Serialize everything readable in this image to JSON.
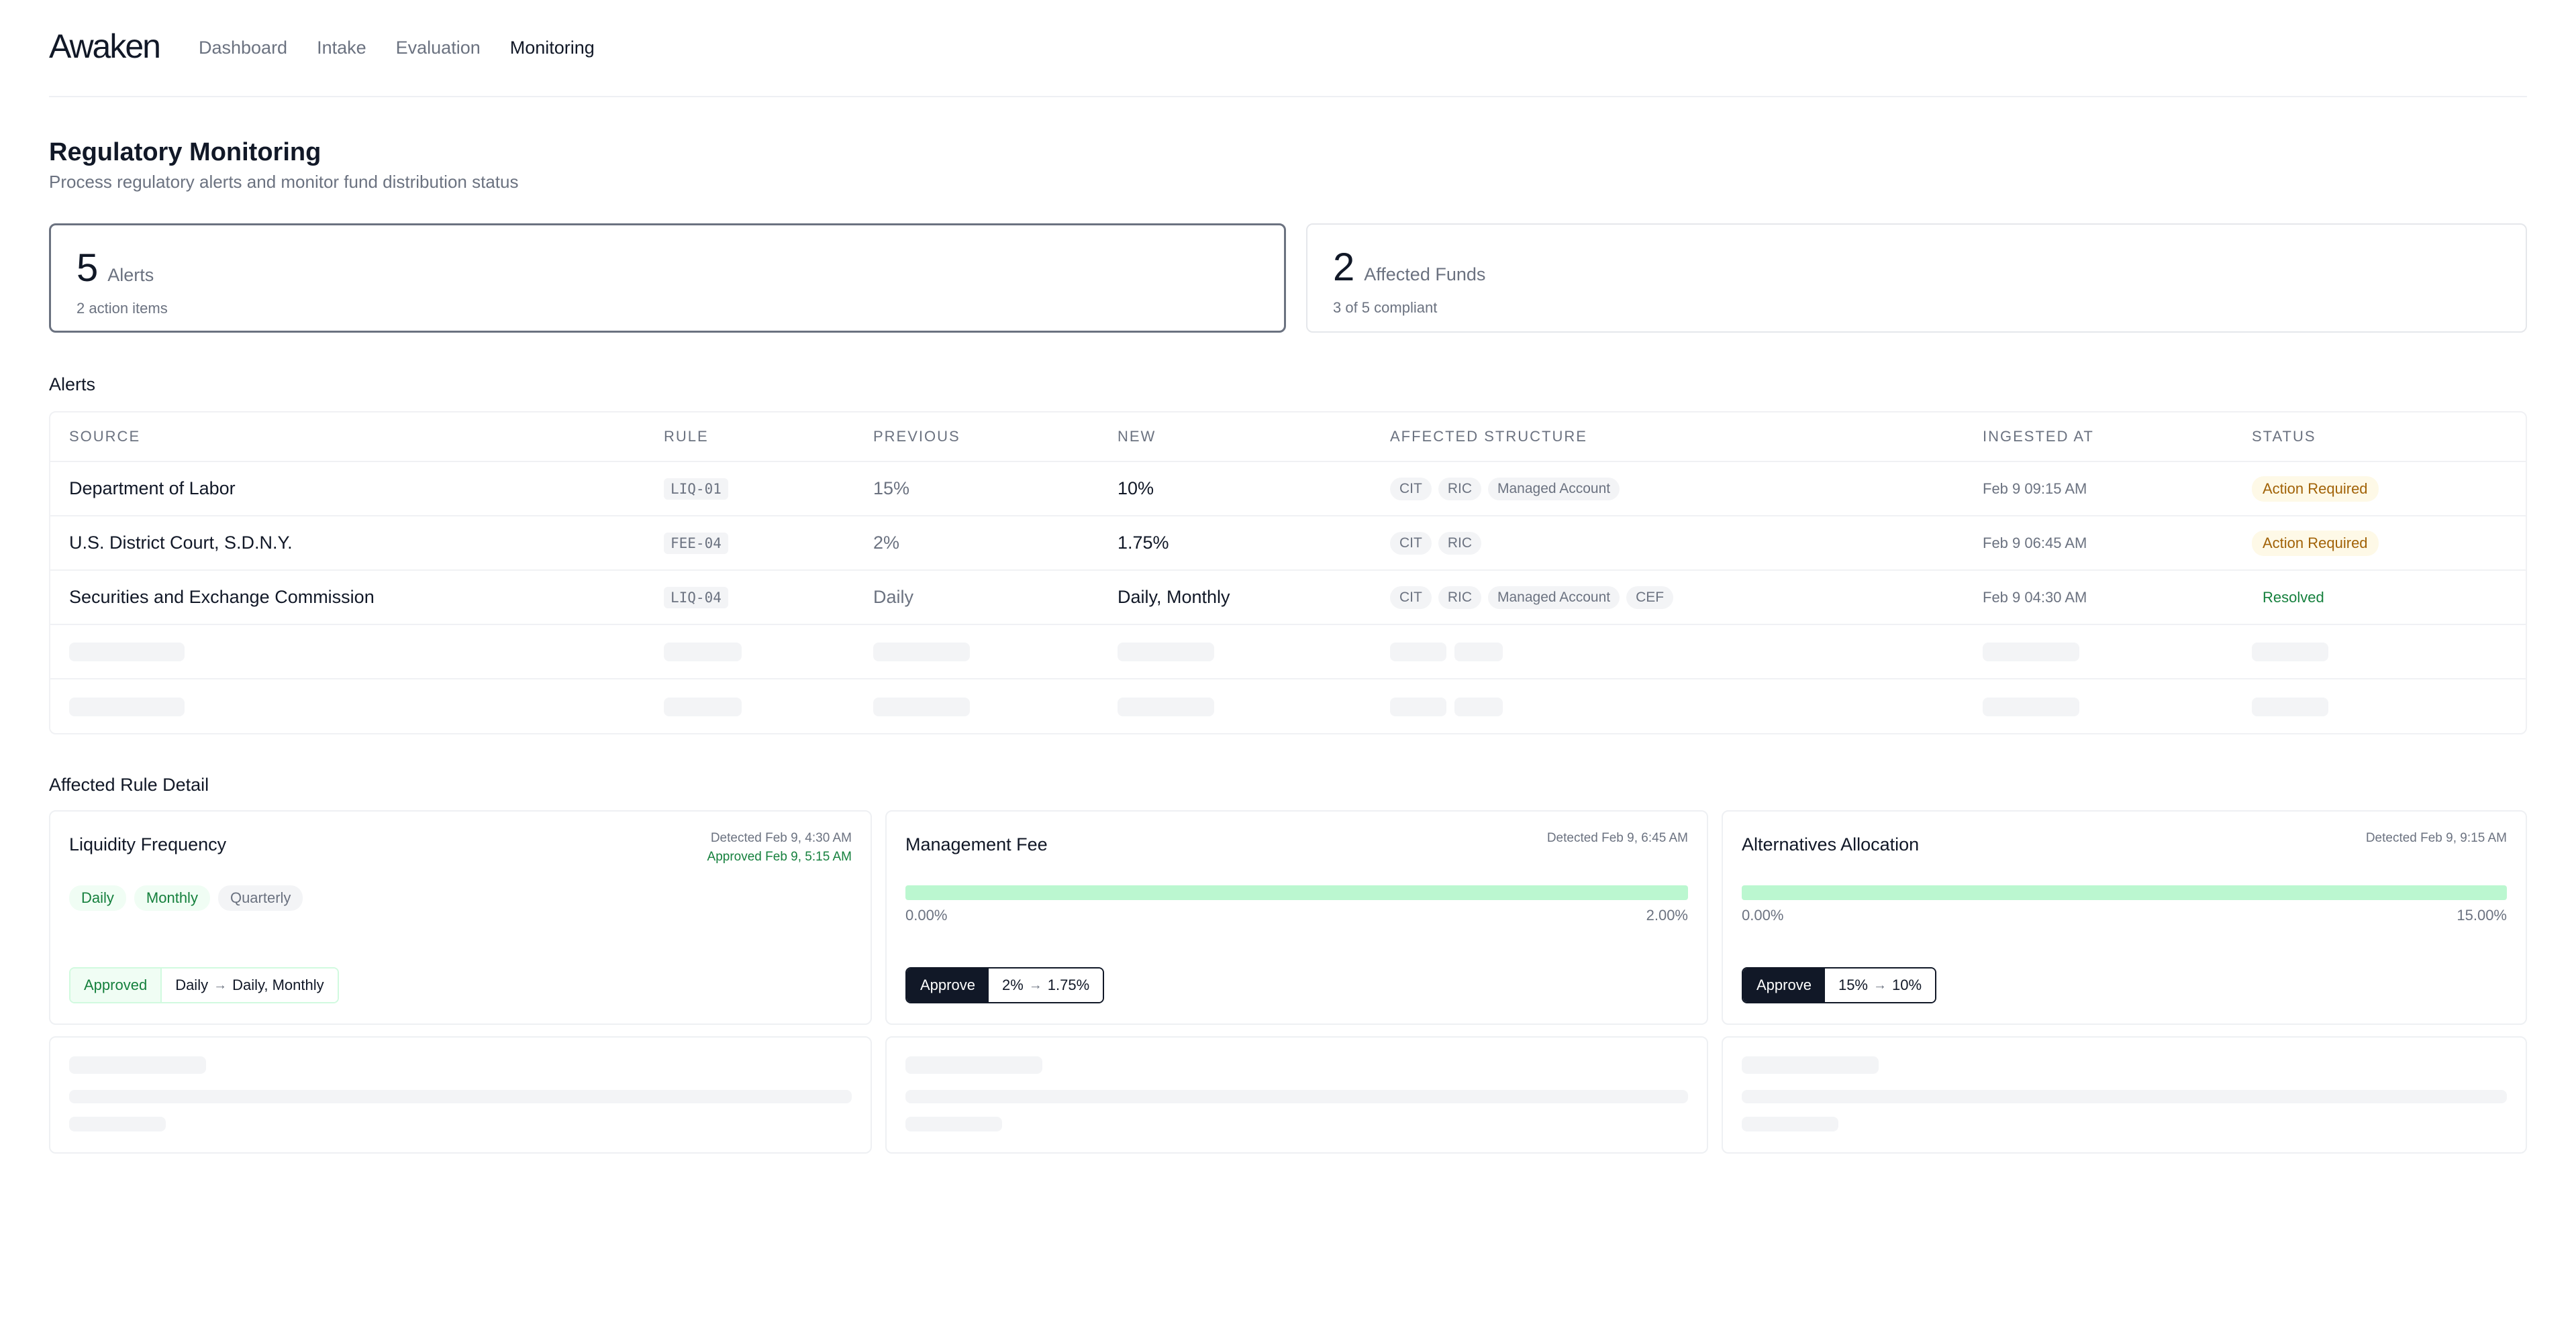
{
  "header": {
    "logo": "Awaken",
    "nav": [
      "Dashboard",
      "Intake",
      "Evaluation",
      "Monitoring"
    ],
    "active_nav": "Monitoring"
  },
  "page": {
    "title": "Regulatory Monitoring",
    "subtitle": "Process regulatory alerts and monitor fund distribution status"
  },
  "stats": [
    {
      "value": "5",
      "label": "Alerts",
      "sub": "2 action items"
    },
    {
      "value": "2",
      "label": "Affected Funds",
      "sub": "3 of 5 compliant"
    }
  ],
  "alerts": {
    "heading": "Alerts",
    "columns": [
      "SOURCE",
      "RULE",
      "PREVIOUS",
      "NEW",
      "AFFECTED STRUCTURE",
      "INGESTED AT",
      "STATUS"
    ],
    "rows": [
      {
        "source": "Department of Labor",
        "rule": "LIQ-01",
        "previous": "15%",
        "new": "10%",
        "structures": [
          "CIT",
          "RIC",
          "Managed Account"
        ],
        "ingested": "Feb 9 09:15 AM",
        "status": "Action Required"
      },
      {
        "source": "U.S. District Court, S.D.N.Y.",
        "rule": "FEE-04",
        "previous": "2%",
        "new": "1.75%",
        "structures": [
          "CIT",
          "RIC"
        ],
        "ingested": "Feb 9 06:45 AM",
        "status": "Action Required"
      },
      {
        "source": "Securities and Exchange Commission",
        "rule": "LIQ-04",
        "previous": "Daily",
        "new": "Daily, Monthly",
        "structures": [
          "CIT",
          "RIC",
          "Managed Account",
          "CEF"
        ],
        "ingested": "Feb 9 04:30 AM",
        "status": "Resolved"
      }
    ]
  },
  "detail": {
    "heading": "Affected Rule Detail",
    "cards": [
      {
        "title": "Liquidity Frequency",
        "detected": "Detected Feb 9, 4:30 AM",
        "approved": "Approved Feb 9, 5:15 AM",
        "chips": [
          "Daily",
          "Monthly",
          "Quarterly"
        ],
        "action_label": "Approved",
        "from": "Daily",
        "to": "Daily, Monthly"
      },
      {
        "title": "Management Fee",
        "detected": "Detected Feb 9, 6:45 AM",
        "bar_min": "0.00%",
        "bar_max": "2.00%",
        "bar_fill_fraction": 1.0,
        "action_label": "Approve",
        "from": "2%",
        "to": "1.75%"
      },
      {
        "title": "Alternatives Allocation",
        "detected": "Detected Feb 9, 9:15 AM",
        "bar_min": "0.00%",
        "bar_max": "15.00%",
        "bar_fill_fraction": 1.0,
        "action_label": "Approve",
        "from": "15%",
        "to": "10%"
      }
    ]
  },
  "colors": {
    "accent": "#111827",
    "success": "#15803d",
    "warning": "#a16207",
    "bar": "#bbf7d0"
  },
  "icons": {
    "arrow": "arrow-right-icon"
  }
}
